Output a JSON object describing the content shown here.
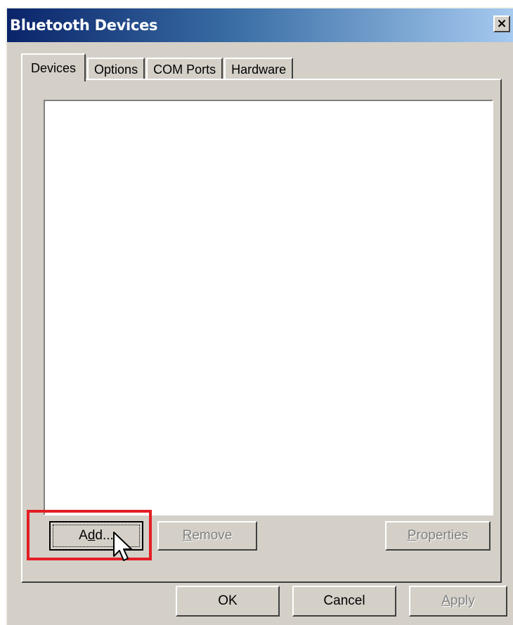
{
  "window": {
    "title": "Bluetooth Devices",
    "close_label": "×"
  },
  "tabs": [
    {
      "label": "Devices",
      "active": true
    },
    {
      "label": "Options",
      "active": false
    },
    {
      "label": "COM Ports",
      "active": false
    },
    {
      "label": "Hardware",
      "active": false
    }
  ],
  "device_list": {
    "items": []
  },
  "panel_buttons": {
    "add": {
      "label_pre": "A",
      "label_ul": "d",
      "label_post": "d...",
      "enabled": true,
      "highlighted": true
    },
    "remove": {
      "label_ul": "R",
      "label_post": "emove",
      "enabled": false
    },
    "properties": {
      "label_ul": "P",
      "label_post": "roperties",
      "enabled": false
    }
  },
  "dialog_buttons": {
    "ok": {
      "label": "OK",
      "enabled": true
    },
    "cancel": {
      "label": "Cancel",
      "enabled": true
    },
    "apply": {
      "label_ul": "A",
      "label_post": "pply",
      "enabled": false
    }
  },
  "colors": {
    "highlight_box": "#e31e24",
    "title_gradient_start": "#0a246a",
    "title_gradient_end": "#a6caf0",
    "face": "#d4d0c8"
  },
  "icons": {
    "close": "close-icon",
    "cursor": "arrow-cursor-icon"
  }
}
